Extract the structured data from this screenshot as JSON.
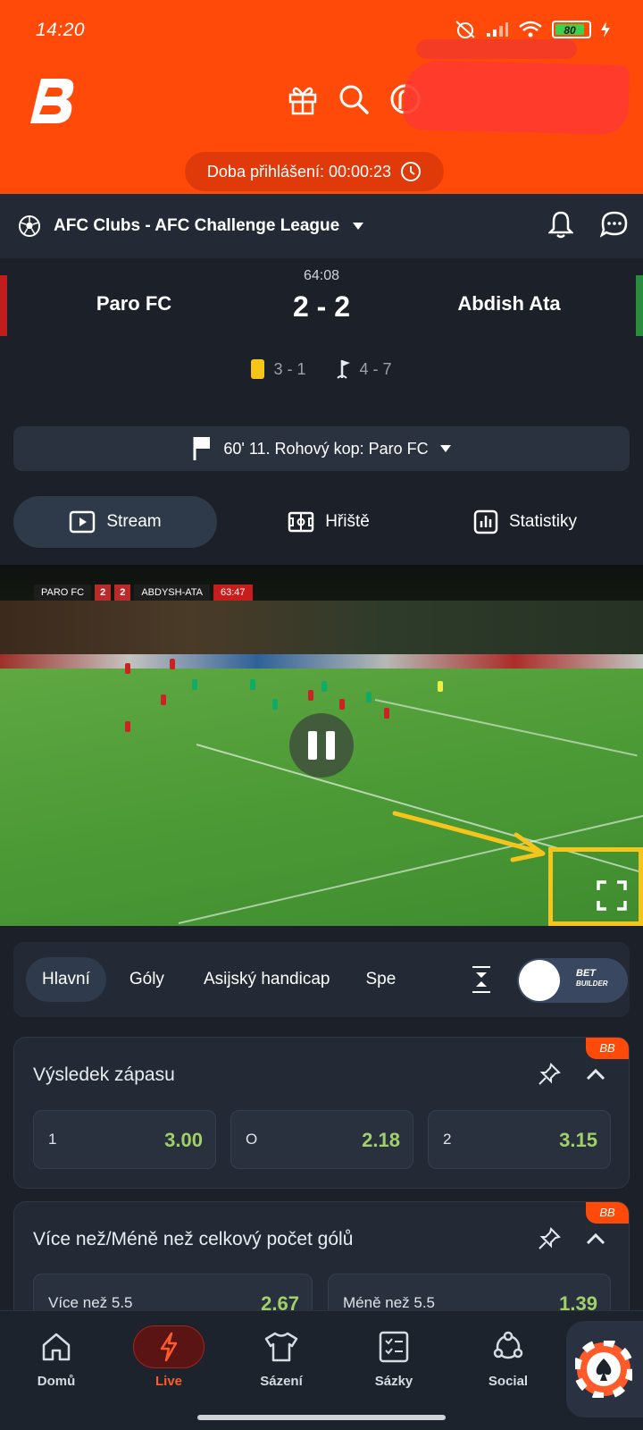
{
  "status": {
    "time": "14:20",
    "battery": "80"
  },
  "login": {
    "label": "Doba přihlášení: 00:00:23"
  },
  "league": {
    "name": "AFC Clubs - AFC Challenge League"
  },
  "match": {
    "clock": "64:08",
    "home": "Paro FC",
    "away": "Abdish Ata",
    "score": "2 - 2",
    "cards": "3 - 1",
    "corners": "4 - 7",
    "event": "60'  11. Rohový kop: Paro FC"
  },
  "tabs": [
    {
      "label": "Stream",
      "icon": "play-icon",
      "active": true
    },
    {
      "label": "Hřiště",
      "icon": "pitch-icon"
    },
    {
      "label": "Statistiky",
      "icon": "stats-icon"
    }
  ],
  "video": {
    "scorebug": {
      "home": "PARO FC",
      "home_goals": "2",
      "away_goals": "2",
      "away": "ABDYSH-ATA",
      "time": "63:47"
    }
  },
  "market_tabs": [
    "Hlavní",
    "Góly",
    "Asijský handicap",
    "Spe"
  ],
  "bet_builder": {
    "line1": "BET",
    "line2": "BUILDER"
  },
  "markets": [
    {
      "title": "Výsledek zápasu",
      "badge": "BB",
      "odds": [
        {
          "label": "1",
          "value": "3.00"
        },
        {
          "label": "O",
          "value": "2.18"
        },
        {
          "label": "2",
          "value": "3.15"
        }
      ]
    },
    {
      "title": "Více než/Méně než celkový počet gólů",
      "badge": "BB",
      "odds": [
        {
          "label": "Více než 5.5",
          "value": "2.67"
        },
        {
          "label": "Méně než 5.5",
          "value": "1.39"
        }
      ]
    }
  ],
  "nav": [
    {
      "label": "Domů",
      "icon": "home-icon"
    },
    {
      "label": "Live",
      "icon": "lightning-icon",
      "active": true
    },
    {
      "label": "Sázení",
      "icon": "jersey-icon"
    },
    {
      "label": "Sázky",
      "icon": "betslip-icon"
    },
    {
      "label": "Social",
      "icon": "social-icon"
    }
  ],
  "colors": {
    "brand": "#ff4a0a",
    "odds": "#9fd06a",
    "card_bg": "#232a36",
    "home_team": "#c21d1d",
    "away_team": "#2a8c3c"
  }
}
